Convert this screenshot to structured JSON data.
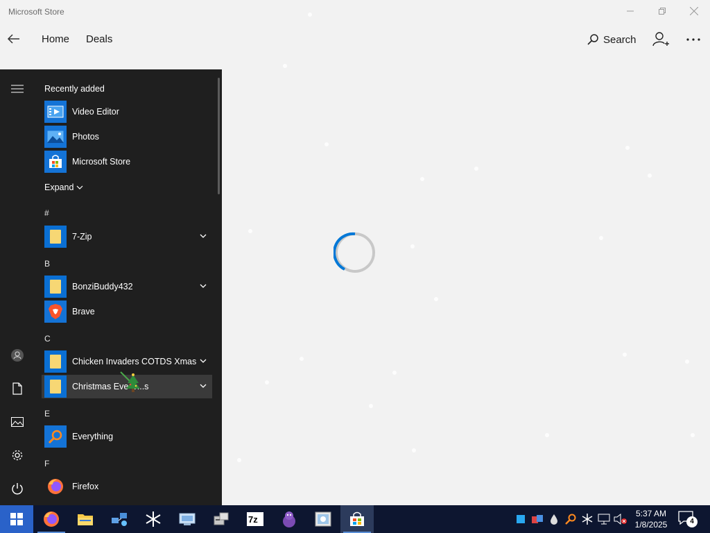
{
  "window": {
    "title": "Microsoft Store"
  },
  "nav": {
    "home": "Home",
    "deals": "Deals",
    "search": "Search"
  },
  "start_menu": {
    "recently_added_label": "Recently added",
    "recent_apps": [
      {
        "label": "Video Editor",
        "icon": "video-editor-icon"
      },
      {
        "label": "Photos",
        "icon": "photos-icon"
      },
      {
        "label": "Microsoft Store",
        "icon": "store-icon"
      }
    ],
    "expand_label": "Expand",
    "sections": {
      "hash": "#",
      "b": "B",
      "c": "C",
      "e": "E",
      "f": "F"
    },
    "apps": {
      "zip": "7-Zip",
      "bonzi": "BonziBuddy432",
      "brave": "Brave",
      "chicken": "Chicken Invaders COTDS Xmas",
      "christmas": "Christmas Eve C...s",
      "everything": "Everything",
      "firefox": "Firefox"
    }
  },
  "taskbar": {
    "time": "5:37 AM",
    "date": "1/8/2025",
    "notification_count": "4",
    "apps": [
      "firefox-icon",
      "file-explorer-icon",
      "network-icon",
      "snowflake-icon",
      "control-panel-icon",
      "installer-icon",
      "7zip-icon",
      "bonzi-icon",
      "photo-viewer-icon",
      "store-icon"
    ]
  },
  "colors": {
    "accent": "#0078d7",
    "start_bg": "#1f1f1f",
    "taskbar_bg": "#0d1630"
  }
}
